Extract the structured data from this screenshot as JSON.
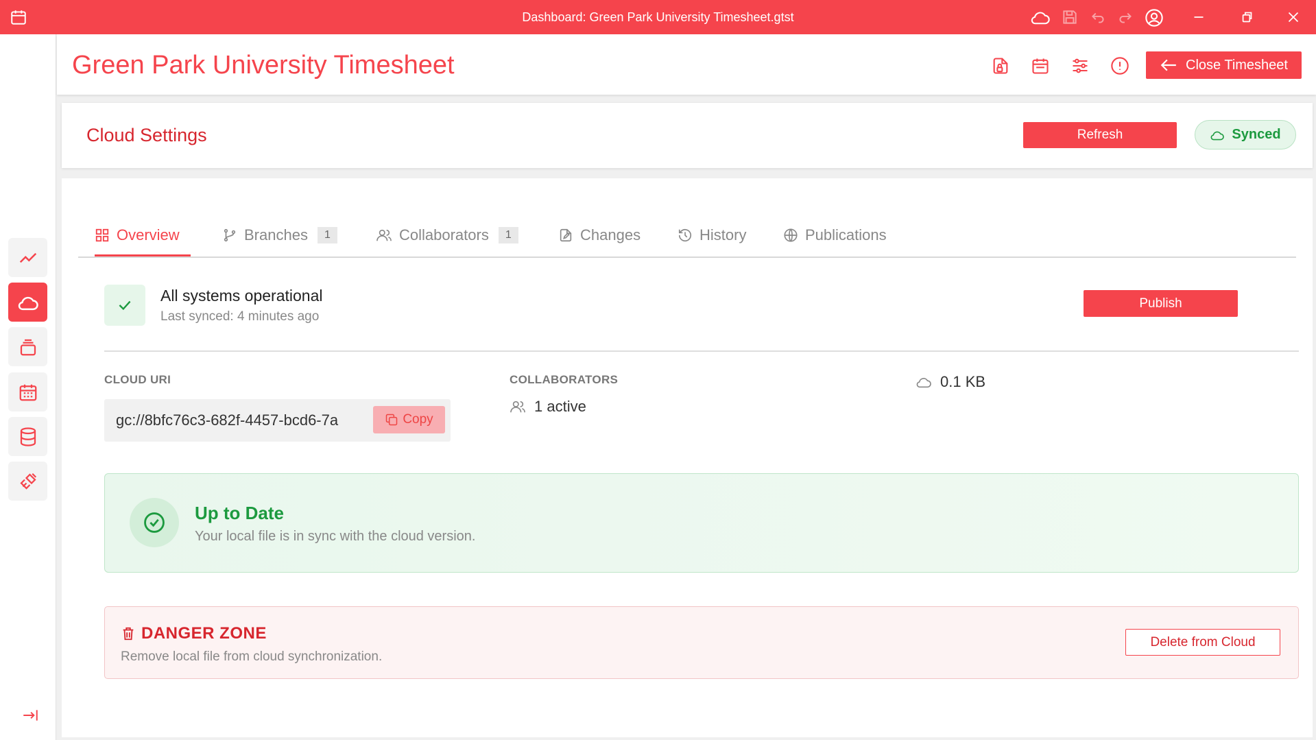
{
  "window": {
    "title": "Dashboard: Green Park University Timesheet.gtst",
    "icons": [
      "calendar-icon",
      "cloud-icon",
      "save-icon",
      "undo-icon",
      "redo-icon",
      "user-circle-icon",
      "minimize-icon",
      "restore-icon",
      "close-icon"
    ]
  },
  "app": {
    "title": "Green Park University Timesheet",
    "close_label": "Close Timesheet",
    "header_icons": [
      "file-lock-icon",
      "calendar-icon",
      "sliders-icon",
      "alert-circle-icon"
    ]
  },
  "sidebar": {
    "items": [
      {
        "icon": "trend-chart-icon",
        "active": false
      },
      {
        "icon": "cloud-icon",
        "active": true
      },
      {
        "icon": "stack-icon",
        "active": false
      },
      {
        "icon": "calendar-grid-icon",
        "active": false
      },
      {
        "icon": "database-icon",
        "active": false
      },
      {
        "icon": "plug-icon",
        "active": false
      }
    ],
    "collapse_icon": "collapse-arrow-icon"
  },
  "settings": {
    "title": "Cloud Settings",
    "refresh_label": "Refresh",
    "sync_status": "Synced"
  },
  "tabs": [
    {
      "label": "Overview",
      "icon": "grid-icon",
      "count": null,
      "active": true
    },
    {
      "label": "Branches",
      "icon": "branch-icon",
      "count": "1",
      "active": false
    },
    {
      "label": "Collaborators",
      "icon": "users-icon",
      "count": "1",
      "active": false
    },
    {
      "label": "Changes",
      "icon": "file-edit-icon",
      "count": null,
      "active": false
    },
    {
      "label": "History",
      "icon": "history-icon",
      "count": null,
      "active": false
    },
    {
      "label": "Publications",
      "icon": "globe-icon",
      "count": null,
      "active": false
    }
  ],
  "status": {
    "title": "All systems operational",
    "subtitle": "Last synced: 4 minutes ago",
    "publish_label": "Publish"
  },
  "info": {
    "uri_label": "CLOUD URI",
    "uri_value": "gc://8bfc76c3-682f-4457-bcd6-7a",
    "copy_label": "Copy",
    "collaborators_label": "COLLABORATORS",
    "collaborators_value": "1 active",
    "size_value": "0.1 KB"
  },
  "sync_state": {
    "title": "Up to Date",
    "subtitle": "Your local file is in sync with the cloud version."
  },
  "danger": {
    "title": "DANGER ZONE",
    "subtitle": "Remove local file from cloud synchronization.",
    "delete_label": "Delete from Cloud"
  },
  "colors": {
    "accent": "#f5444c",
    "accent_dark": "#d7262e",
    "success": "#1c9a3f",
    "success_bg": "#e6f6ea"
  }
}
